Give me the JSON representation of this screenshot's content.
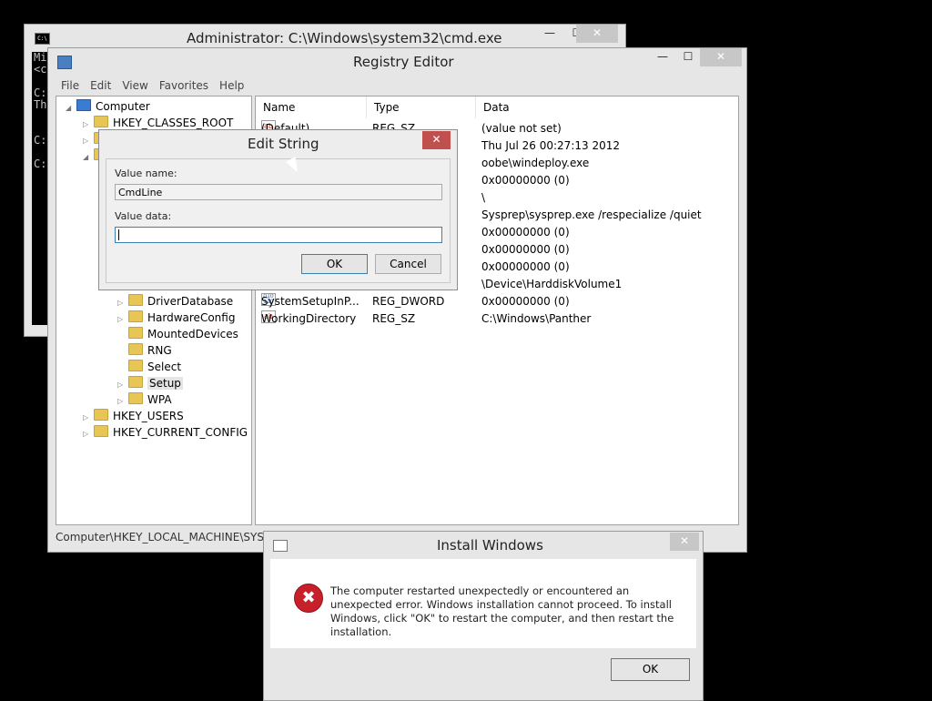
{
  "cmd": {
    "title": "Administrator: C:\\Windows\\system32\\cmd.exe",
    "lines": [
      "Mi",
      "<c",
      "",
      "C:",
      "Th",
      "",
      "",
      "C:",
      "",
      "C:"
    ],
    "minimize": "—",
    "maximize": "☐",
    "close": "✕"
  },
  "regedit": {
    "title": "Registry Editor",
    "minimize": "—",
    "maximize": "☐",
    "close": "✕",
    "menu": [
      "File",
      "Edit",
      "View",
      "Favorites",
      "Help"
    ],
    "tree": {
      "computer": "Computer",
      "hkcr": "HKEY_CLASSES_ROOT",
      "driver_database": "DriverDatabase",
      "hardware_config": "HardwareConfig",
      "mounted_devices": "MountedDevices",
      "rng": "RNG",
      "select": "Select",
      "setup": "Setup",
      "wpa": "WPA",
      "hku": "HKEY_USERS",
      "hkcc": "HKEY_CURRENT_CONFIG"
    },
    "columns": [
      "Name",
      "Type",
      "Data"
    ],
    "rows": [
      {
        "icon": "ab",
        "name": "(Default)",
        "type": "REG_SZ",
        "data": "(value not set)"
      },
      {
        "icon": "",
        "name": "",
        "type": "",
        "data": "Thu Jul 26 00:27:13 2012"
      },
      {
        "icon": "",
        "name": "",
        "type": "",
        "data": "oobe\\windeploy.exe"
      },
      {
        "icon": "",
        "name": "",
        "type": "",
        "data": "0x00000000 (0)"
      },
      {
        "icon": "",
        "name": "",
        "type": "",
        "data": "\\"
      },
      {
        "icon": "",
        "name": "",
        "type": "",
        "data": "Sysprep\\sysprep.exe /respecialize /quiet"
      },
      {
        "icon": "",
        "name": "",
        "type": "",
        "data": "0x00000000 (0)"
      },
      {
        "icon": "",
        "name": "",
        "type": "",
        "data": "0x00000000 (0)"
      },
      {
        "icon": "",
        "name": "",
        "type": "",
        "data": "0x00000000 (0)"
      },
      {
        "icon": "",
        "name": "",
        "type": "",
        "data": "\\Device\\HarddiskVolume1"
      },
      {
        "icon": "bin",
        "name": "SystemSetupInP...",
        "type": "REG_DWORD",
        "data": "0x00000000 (0)"
      },
      {
        "icon": "ab",
        "name": "WorkingDirectory",
        "type": "REG_SZ",
        "data": "C:\\Windows\\Panther"
      }
    ],
    "status": "Computer\\HKEY_LOCAL_MACHINE\\SYSTE"
  },
  "edit_string": {
    "title": "Edit String",
    "close": "✕",
    "value_name_label": "Value name:",
    "value_name": "CmdLine",
    "value_data_label": "Value data:",
    "value_data": "",
    "ok": "OK",
    "cancel": "Cancel"
  },
  "install_windows": {
    "title": "Install Windows",
    "close": "✕",
    "message": "The computer restarted unexpectedly or encountered an unexpected error. Windows installation cannot proceed. To install Windows, click \"OK\" to restart the computer, and then restart the installation.",
    "ok": "OK",
    "error_glyph": "✖"
  }
}
